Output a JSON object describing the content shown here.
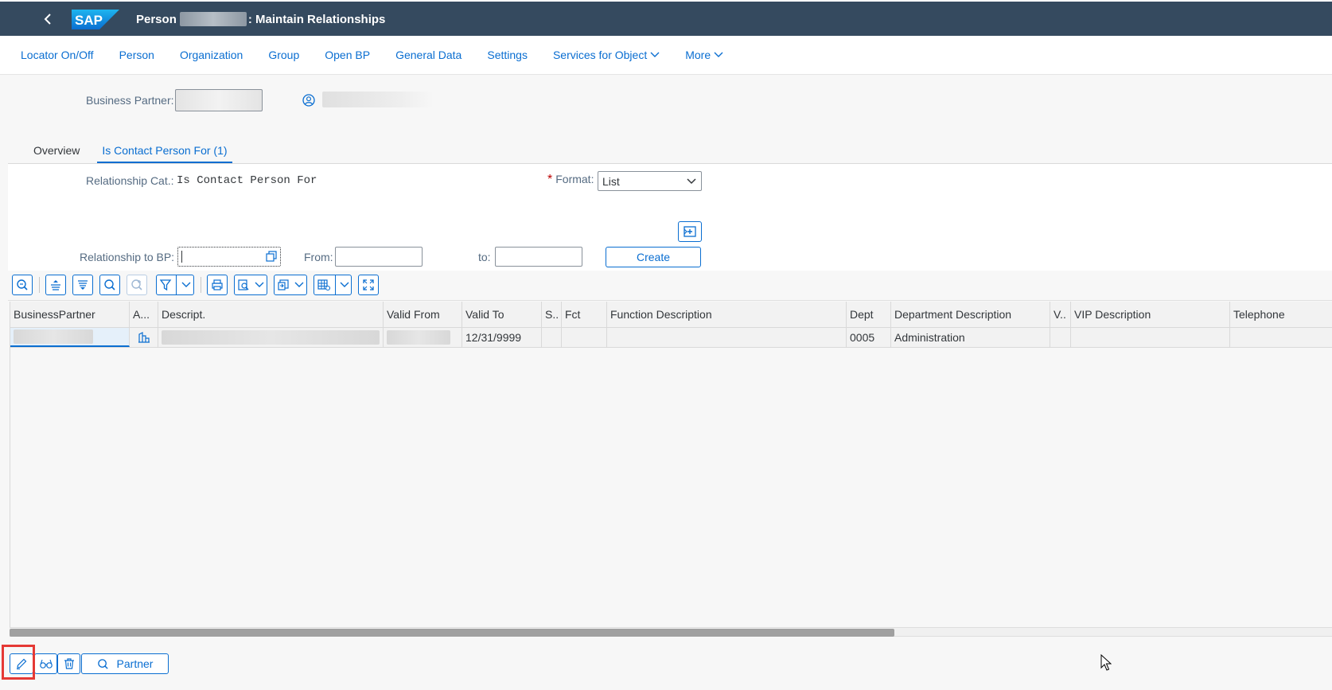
{
  "shell": {
    "title_prefix": "Person",
    "title_suffix": ": Maintain Relationships",
    "logo_text": "SAP"
  },
  "menu": [
    {
      "label": "Locator On/Off",
      "name": "menu-locator"
    },
    {
      "label": "Person",
      "name": "menu-person"
    },
    {
      "label": "Organization",
      "name": "menu-organization"
    },
    {
      "label": "Group",
      "name": "menu-group"
    },
    {
      "label": "Open BP",
      "name": "menu-open-bp"
    },
    {
      "label": "General Data",
      "name": "menu-general-data"
    },
    {
      "label": "Settings",
      "name": "menu-settings"
    },
    {
      "label": "Services for Object",
      "name": "menu-services",
      "dropdown": true
    },
    {
      "label": "More",
      "name": "menu-more",
      "dropdown": true
    }
  ],
  "header": {
    "bp_label": "Business Partner:"
  },
  "tabs": {
    "overview": "Overview",
    "contact": "Is Contact Person For (1)"
  },
  "panel": {
    "rel_cat_label": "Relationship Cat.:",
    "rel_cat_value": "Is Contact Person For",
    "format_label": "Format:",
    "format_value": "List",
    "rel_bp_label": "Relationship to BP:",
    "from_label": "From:",
    "to_label": "to:",
    "create_label": "Create"
  },
  "grid": {
    "columns": [
      "BusinessPartner",
      "A...",
      "Descript.",
      "Valid From",
      "Valid To",
      "S..",
      "Fct",
      "Function Description",
      "Dept",
      "Department Description",
      "V..",
      "VIP Description",
      "Telephone"
    ],
    "row": {
      "valid_to": "12/31/9999",
      "dept": "0005",
      "dept_desc": "Administration"
    }
  },
  "footer": {
    "partner_label": "Partner"
  },
  "colors": {
    "shell": "#354a5f",
    "accent": "#0a6ed1",
    "highlight": "#e53935"
  }
}
